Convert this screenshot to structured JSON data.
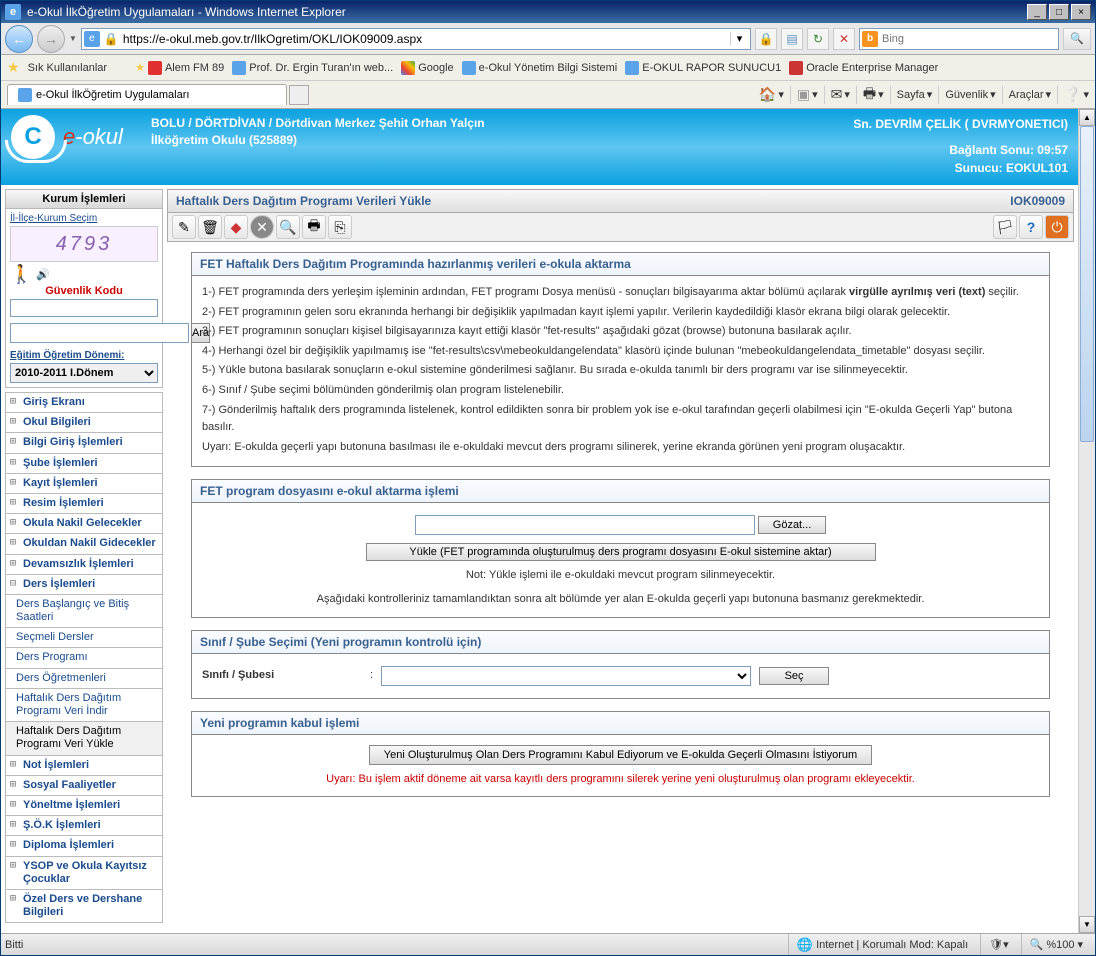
{
  "window": {
    "title": "e-Okul İlkÖğretim Uygulamaları - Windows Internet Explorer"
  },
  "address": {
    "url": "https://e-okul.meb.gov.tr/IlkOgretim/OKL/IOK09009.aspx"
  },
  "search": {
    "placeholder": "Bing"
  },
  "favbar": {
    "label": "Sık Kullanılanlar",
    "links": [
      "Alem FM 89",
      "Prof. Dr. Ergin Turan'ın web...",
      "Google",
      "e-Okul Yönetim Bilgi Sistemi",
      "E-OKUL RAPOR SUNUCU1",
      "Oracle Enterprise Manager"
    ]
  },
  "tab": {
    "title": "e-Okul İlkÖğretim Uygulamaları"
  },
  "cmdbar": {
    "page": "Sayfa",
    "safety": "Güvenlik",
    "tools": "Araçlar"
  },
  "header": {
    "line1": "BOLU / DÖRTDİVAN / Dörtdivan Merkez Şehit Orhan Yalçın",
    "line2": "İlköğretim Okulu (525889)",
    "user": "Sn. DEVRİM ÇELİK ( DVRMYONETICI)",
    "timeout": "Bağlantı Sonu: 09:57",
    "server": "Sunucu: EOKUL101"
  },
  "sidebar": {
    "title": "Kurum İşlemleri",
    "sec_link": "İl-İlçe-Kurum Seçim",
    "captcha": "4793",
    "gk": "Güvenlik Kodu",
    "ara": "Ara",
    "donem_label": "Eğitim Öğretim Dönemi:",
    "donem_value": "2010-2011 I.Dönem",
    "menu": [
      "Giriş Ekranı",
      "Okul Bilgileri",
      "Bilgi Giriş İşlemleri",
      "Şube İşlemleri",
      "Kayıt İşlemleri",
      "Resim İşlemleri",
      "Okula Nakil Gelecekler",
      "Okuldan Nakil Gidecekler",
      "Devamsızlık İşlemleri"
    ],
    "ders_head": "Ders İşlemleri",
    "ders_sub": [
      "Ders Başlangıç ve Bitiş Saatleri",
      "Seçmeli Dersler",
      "Ders Programı",
      "Ders Öğretmenleri",
      "Haftalık Ders Dağıtım Programı Veri İndir",
      "Haftalık Ders Dağıtım Programı Veri Yükle"
    ],
    "menu2": [
      "Not İşlemleri",
      "Sosyal Faaliyetler",
      "Yöneltme İşlemleri",
      "Ş.Ö.K İşlemleri",
      "Diploma İşlemleri",
      "YSOP ve Okula Kayıtsız Çocuklar",
      "Özel Ders ve Dershane Bilgileri"
    ]
  },
  "page": {
    "title": "Haftalık Ders Dağıtım Programı Verileri Yükle",
    "code": "IOK09009",
    "instr_title": "FET Haftalık Ders Dağıtım Programında hazırlanmış verileri e-okula aktarma",
    "instr": [
      "1-) FET programında ders yerleşim işleminin ardından, FET programı Dosya menüsü - sonuçları bilgisayarıma aktar bölümü açılarak virgülle ayrılmış veri (text) seçilir.",
      "2-) FET programının gelen soru ekranında herhangi bir değişiklik yapılmadan kayıt işlemi yapılır. Verilerin kaydedildiği klasör ekrana bilgi olarak gelecektir.",
      "3-) FET programının sonuçları kişisel bilgisayarınıza kayıt ettiği klasör \"fet-results\" aşağıdaki gözat (browse)  butonuna basılarak açılır.",
      "4-) Herhangi özel bir değişiklik yapılmamış ise \"fet-results\\csv\\mebeokuldangelendata\" klasörü içinde bulunan \"mebeokuldangelendata_timetable\" dosyası seçilir.",
      "5-) Yükle butona basılarak sonuçların e-okul sistemine gönderilmesi sağlanır. Bu sırada e-okulda tanımlı bir ders programı var ise silinmeyecektir.",
      "6-) Sınıf / Şube seçimi bölümünden gönderilmiş olan program listelenebilir.",
      "7-) Gönderilmiş haftalık ders programında listelenek, kontrol edildikten sonra bir problem yok ise e-okul tarafından geçerli olabilmesi için \"E-okulda Geçerli Yap\" butona basılır.",
      "     Uyarı: E-okulda geçerli yapı butonuna basılması ile e-okuldaki mevcut ders programı silinerek, yerine ekranda görünen yeni program oluşacaktır."
    ],
    "box2_title": "FET program dosyasını e-okul aktarma işlemi",
    "browse": "Gözat...",
    "upload_btn": "Yükle (FET programında oluşturulmuş ders programı dosyasını E-okul sistemine aktar)",
    "note1": "Not: Yükle işlemi ile e-okuldaki mevcut program silinmeyecektir.",
    "note2": "Aşağıdaki kontrolleriniz tamamlandıktan sonra alt bölümde yer alan E-okulda geçerli yapı butonuna basmanız gerekmektedir.",
    "box3_title": "Sınıf / Şube Seçimi (Yeni programın kontrolü için)",
    "sinif_label": "Sınıfı / Şubesi",
    "sec": "Seç",
    "box4_title": "Yeni programın kabul işlemi",
    "kabul_btn": "Yeni Oluşturulmuş Olan Ders Programını Kabul Ediyorum ve E-okulda Geçerli Olmasını İstiyorum",
    "kabul_warn": "Uyarı: Bu işlem aktif döneme ait varsa kayıtlı ders programını silerek yerine yeni oluşturulmuş olan programı ekleyecektir."
  },
  "status": {
    "left": "Bitti",
    "zone": "Internet | Korumalı Mod: Kapalı",
    "zoom": "%100"
  }
}
